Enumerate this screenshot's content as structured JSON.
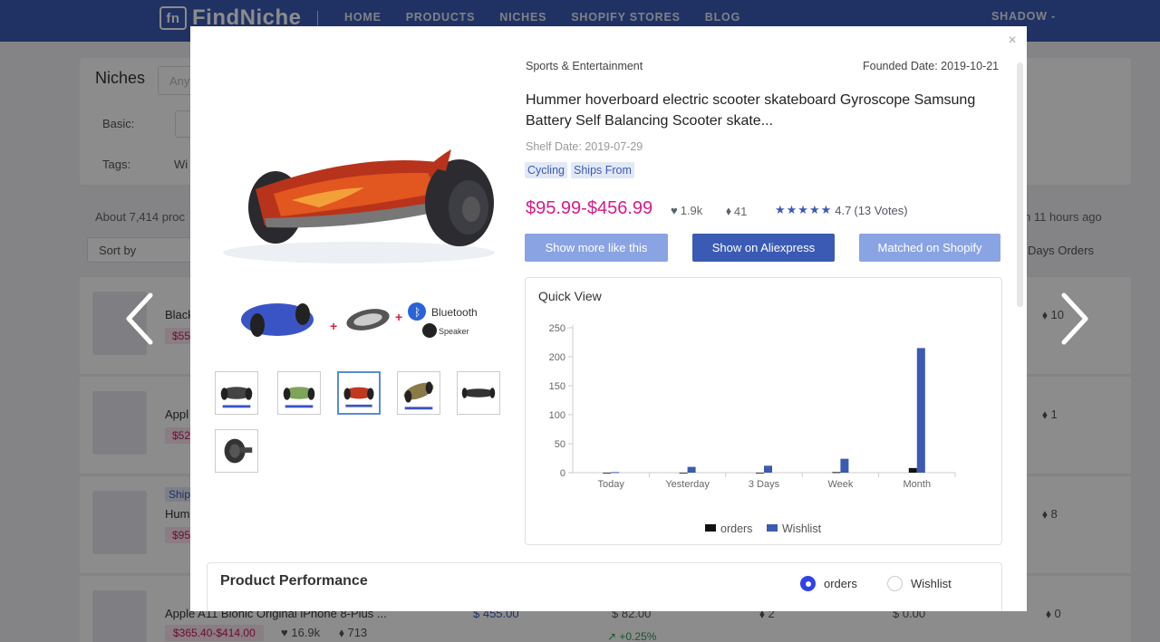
{
  "nav": {
    "brand": "FindNiche",
    "links": [
      "HOME",
      "PRODUCTS",
      "NICHES",
      "SHOPIFY STORES",
      "BLOG"
    ],
    "user": "SHADOW -"
  },
  "background": {
    "filter_title": "Niches",
    "search_placeholder": "Any",
    "basic_label": "Basic:",
    "tags_label": "Tags:",
    "tags_value": "Wi",
    "results_count": "About 7,414 proc",
    "updated": "n 11 hours ago",
    "sort_by": "Sort by",
    "days_orders": "Days Orders",
    "rows": [
      {
        "title": "Black",
        "price": "$55",
        "right": "10"
      },
      {
        "title": "Appl",
        "price": "$52",
        "right": "1"
      },
      {
        "tag": "Ship",
        "title": "Hum",
        "price": "$95",
        "right": "8"
      }
    ],
    "bottom_row": {
      "title": "Apple A11 Bionic Original iPhone 8-Plus ...",
      "price": "$365.40-$414.00",
      "likes": "16.9k",
      "tags": "713",
      "col1": "$ 455.00",
      "col2": "82.00",
      "col3": "2",
      "col4": "0.00",
      "col5": "0",
      "trend": "+0.25%"
    }
  },
  "modal": {
    "category": "Sports & Entertainment",
    "founded": "Founded Date: 2019-10-21",
    "title": "Hummer hoverboard electric scooter skateboard Gyroscope Samsung Battery Self Balancing Scooter skate...",
    "shelf_date": "Shelf Date: 2019-07-29",
    "tags": [
      "Cycling",
      "Ships From"
    ],
    "price": "$95.99-$456.99",
    "likes": "1.9k",
    "tag_count": "41",
    "rating": "4.7",
    "votes": "(13 Votes)",
    "buttons": {
      "more": "Show more like this",
      "ali": "Show on Aliexpress",
      "shopify": "Matched on Shopify"
    },
    "promo_text": {
      "bluetooth": "Bluetooth",
      "speaker": "Speaker"
    },
    "performance": {
      "title": "Product Performance",
      "options": [
        "orders",
        "Wishlist"
      ],
      "selected": "orders"
    }
  },
  "chart_data": {
    "type": "bar",
    "title": "Quick View",
    "categories": [
      "Today",
      "Yesterday",
      "3 Days",
      "Week",
      "Month"
    ],
    "series": [
      {
        "name": "orders",
        "color": "#111111",
        "values": [
          0,
          0,
          0,
          1,
          8
        ]
      },
      {
        "name": "Wishlist",
        "color": "#3b5ab4",
        "values": [
          1,
          10,
          12,
          24,
          215
        ]
      }
    ],
    "yticks": [
      0,
      50,
      100,
      150,
      200,
      250
    ],
    "ylim": [
      0,
      250
    ],
    "legend": "bottom"
  }
}
